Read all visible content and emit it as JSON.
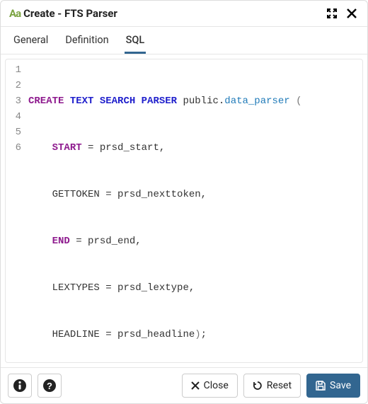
{
  "titlebar": {
    "logo": "Aa",
    "title": "Create - FTS Parser"
  },
  "tabs": [
    {
      "label": "General",
      "active": false
    },
    {
      "label": "Definition",
      "active": false
    },
    {
      "label": "SQL",
      "active": true
    }
  ],
  "sql": {
    "line_numbers": [
      "1",
      "2",
      "3",
      "4",
      "5",
      "6"
    ],
    "tokens": {
      "create": "CREATE",
      "text_search_parser": "TEXT SEARCH PARSER",
      "schema": "public",
      "dot": ".",
      "name": "data_parser",
      "open": "(",
      "start_kw": "START",
      "eq": " = ",
      "start_val": "prsd_start",
      "comma": ",",
      "gettoken_kw": "GETTOKEN",
      "gettoken_val": "prsd_nexttoken",
      "end_kw": "END",
      "end_val": "prsd_end",
      "lextypes_kw": "LEXTYPES",
      "lextypes_val": "prsd_lextype",
      "headline_kw": "HEADLINE",
      "headline_val": "prsd_headline",
      "close": ")",
      "semi": ";"
    }
  },
  "footer": {
    "close": "Close",
    "reset": "Reset",
    "save": "Save"
  }
}
